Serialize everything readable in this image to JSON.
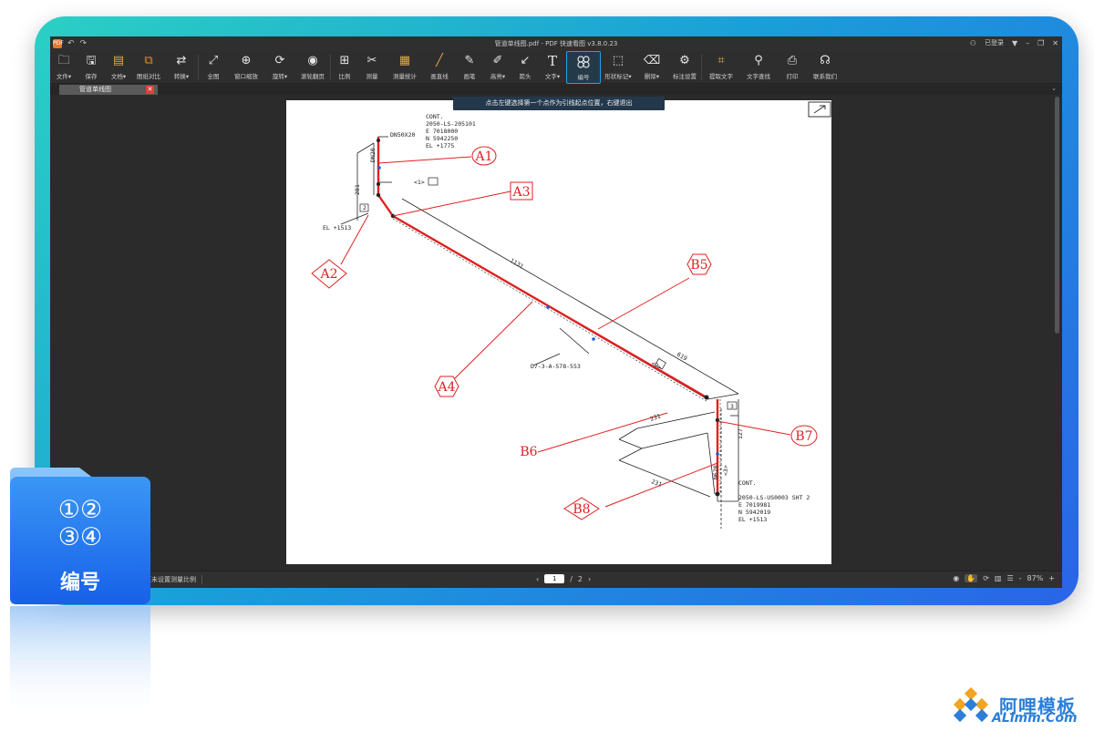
{
  "window": {
    "title": "管道单线图.pdf - PDF 快速看图 v3.8.0.23",
    "login": "已登录",
    "app_icon": "PDF"
  },
  "toolbar": {
    "items": [
      {
        "label": "文件▾",
        "icon": "folder-icon"
      },
      {
        "label": "保存",
        "icon": "save-icon"
      },
      {
        "label": "文档▾",
        "icon": "document-icon"
      },
      {
        "label": "图纸对比",
        "icon": "compare-icon"
      },
      {
        "label": "转换▾",
        "icon": "convert-icon"
      },
      {
        "label": "全图",
        "icon": "fit-all-icon"
      },
      {
        "label": "窗口缩放",
        "icon": "window-zoom-icon"
      },
      {
        "label": "旋转▾",
        "icon": "rotate-icon"
      },
      {
        "label": "滚轮翻页",
        "icon": "scroll-wheel-icon"
      },
      {
        "label": "比例",
        "icon": "scale-icon"
      },
      {
        "label": "测量",
        "icon": "measure-icon"
      },
      {
        "label": "测量统计",
        "icon": "measure-stats-icon"
      },
      {
        "label": "画直线",
        "icon": "line-icon"
      },
      {
        "label": "画笔",
        "icon": "pen-icon"
      },
      {
        "label": "高亮▾",
        "icon": "highlight-icon"
      },
      {
        "label": "箭头",
        "icon": "arrow-icon"
      },
      {
        "label": "文字▾",
        "icon": "text-icon"
      },
      {
        "label": "编号",
        "icon": "numbering-icon"
      },
      {
        "label": "形状标记▾",
        "icon": "shape-mark-icon"
      },
      {
        "label": "删除▾",
        "icon": "eraser-icon"
      },
      {
        "label": "标注设置",
        "icon": "annotation-settings-icon"
      },
      {
        "label": "提取文字",
        "icon": "extract-text-icon"
      },
      {
        "label": "文字查找",
        "icon": "search-icon"
      },
      {
        "label": "打印",
        "icon": "print-icon"
      },
      {
        "label": "联系我们",
        "icon": "headset-icon"
      }
    ],
    "active_label": "编号"
  },
  "tab": {
    "label": "管道单线图"
  },
  "tooltip": "点击左键选择第一个点作为引线起点位置，右键退出",
  "drawing": {
    "cont_top": [
      "CONT.",
      "2050-LS-205101",
      "E 7018000",
      "N 5942250",
      "EL +1775"
    ],
    "cont_bottom": [
      "CONT.",
      "2050-LS-US0003 SHT 2",
      "E 7019981",
      "N 5942019",
      "EL +1513"
    ],
    "el_left": "EL +1513",
    "dn_label": "DN50X20",
    "line_tag": "D7-3-A-578-553",
    "dims": [
      "1131",
      "619",
      "281",
      "DN20",
      "N620",
      "1 1",
      "<1>",
      "<2>",
      "2",
      "3",
      "231",
      "127",
      "<3>",
      "231"
    ],
    "balloons": [
      "A1",
      "A2",
      "A3",
      "A4",
      "B5",
      "B6",
      "B7",
      "B8"
    ]
  },
  "statusbar": {
    "scale_info": "页未设置测量比例",
    "current_page": "1",
    "page_sep": "/",
    "total_pages": "2",
    "zoom": "87%",
    "zoom_minus": "-",
    "zoom_plus": "+"
  },
  "badge": {
    "icon_text": "①②\n③④",
    "row1": "①②",
    "row2": "③④",
    "label": "编号"
  },
  "watermark": {
    "text": "阿哩模板",
    "sub": "ALimm.Com"
  },
  "colors": {
    "accent": "#1fa0e8",
    "annotation": "#e02020",
    "bezel_start": "#2ad0c4",
    "bezel_end": "#2a64e8",
    "badge_blue": "#1f7ef0"
  }
}
